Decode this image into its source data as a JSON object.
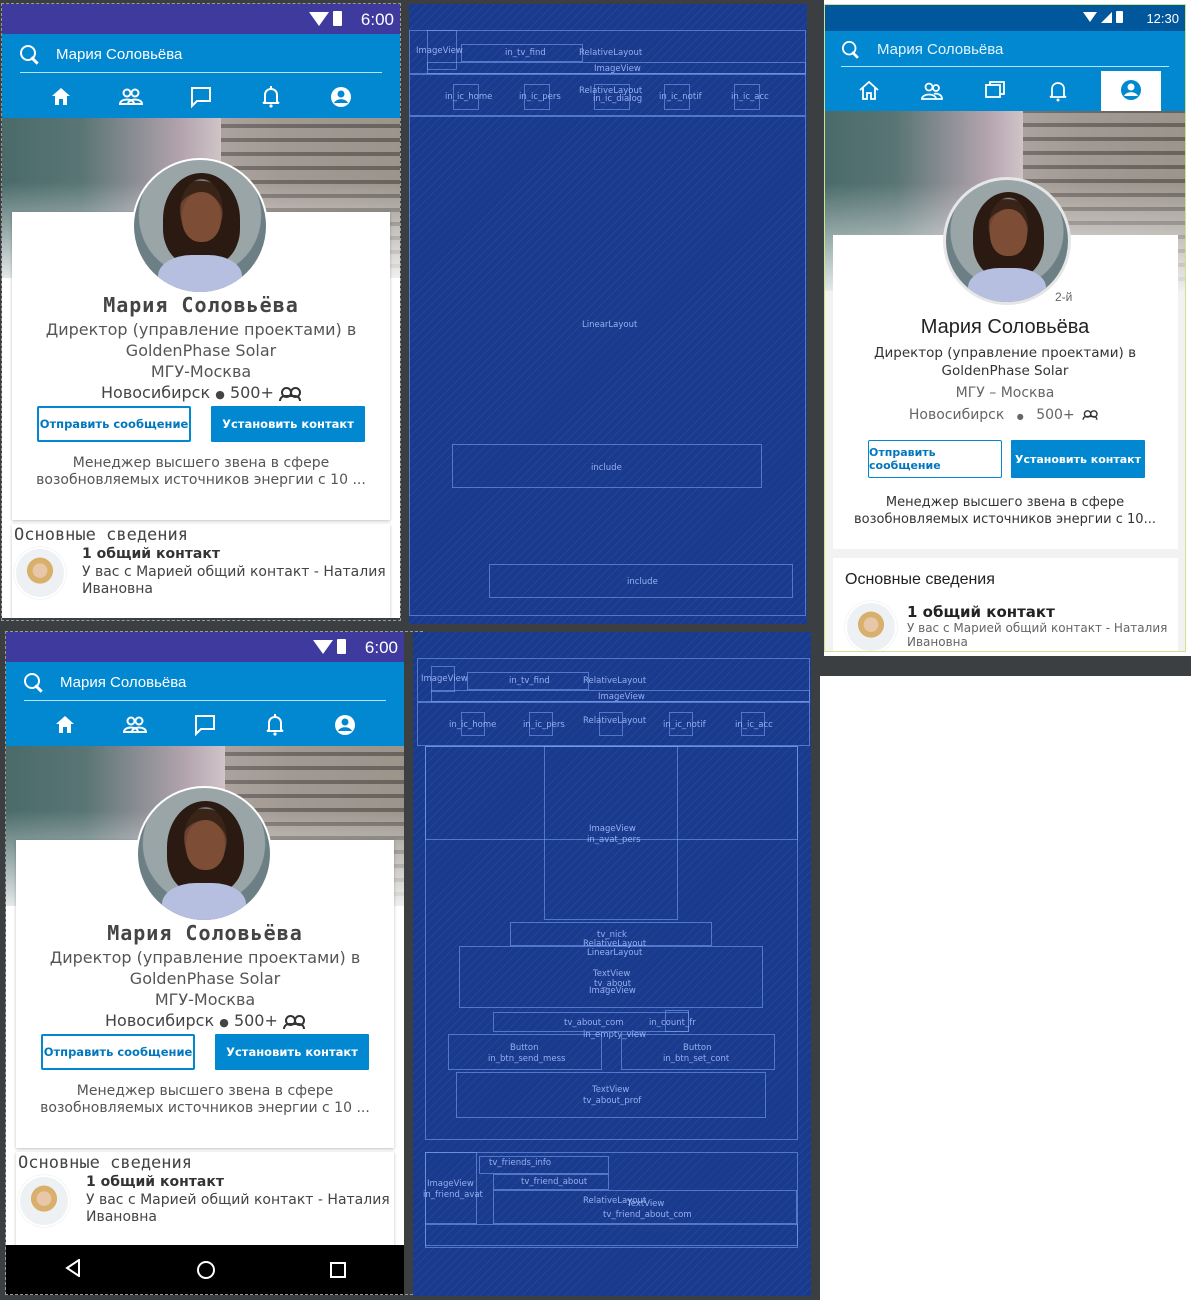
{
  "status": {
    "time_main": "6:00",
    "time_preview": "12:30"
  },
  "search": {
    "text": "Мария Соловьёва"
  },
  "nav": {
    "items": [
      {
        "name": "home-icon"
      },
      {
        "name": "people-icon"
      },
      {
        "name": "chat-icon"
      },
      {
        "name": "bell-icon"
      },
      {
        "name": "account-icon"
      }
    ]
  },
  "profile": {
    "name": "Мария Соловьёва",
    "degree": "2-й",
    "title_line1": "Директор (управление проектами) в",
    "title_line2": "GoldenPhase Solar",
    "school": "МГУ-Москва",
    "school_preview": "МГУ – Москва",
    "location": "Новосибирск",
    "bullet": "●",
    "connections": "500+",
    "send_message": "Отправить сообщение",
    "add_contact": "Установить контакт",
    "about_line1": "Менеджер высшего звена в сфере",
    "about_line2": "возобновляемых источников энергии с 10 ...",
    "about_line2_preview": "возобновляемых источников энергии с 10..."
  },
  "info": {
    "title": "Основные сведения",
    "friend_title": "1 общий контакт",
    "friend_text_line1": "У вас с Марией общий контакт - Наталия",
    "friend_text_line2": "Ивановна"
  },
  "blueprint": {
    "top": {
      "labels": [
        "ImageView",
        "in_tv_find",
        "RelativeLayout",
        "ImageView",
        "in_ic_home",
        "in_ic_pers",
        "RelativeLayout",
        "in_ic_dialog",
        "in_ic_notif",
        "in_ic_acc",
        "LinearLayout",
        "include",
        "include"
      ]
    },
    "bottom": {
      "labels": [
        "ImageView",
        "in_tv_find",
        "RelativeLayout",
        "ImageView",
        "in_ic_home",
        "in_ic_pers",
        "RelativeLayout",
        "in_ic_notif",
        "in_ic_acc",
        "ImageView",
        "in_avat_pers",
        "tv_nick",
        "RelativeLayout",
        "LinearLayout",
        "TextView",
        "tv_about",
        "ImageView",
        "tv_about_com",
        "in_count_fr",
        "in_empty_view",
        "Button",
        "in_btn_send_mess",
        "Button",
        "in_btn_set_cont",
        "TextView",
        "tv_about_prof",
        "tv_friends_info",
        "ImageView",
        "in_friend_avat",
        "tv_friend_about",
        "RelativeLayout",
        "TextView",
        "tv_friend_about_com"
      ]
    }
  },
  "colors": {
    "appbar": "#0288d1",
    "statusbar": "#3f3a9e",
    "blueprint": "#1a3a8e"
  }
}
